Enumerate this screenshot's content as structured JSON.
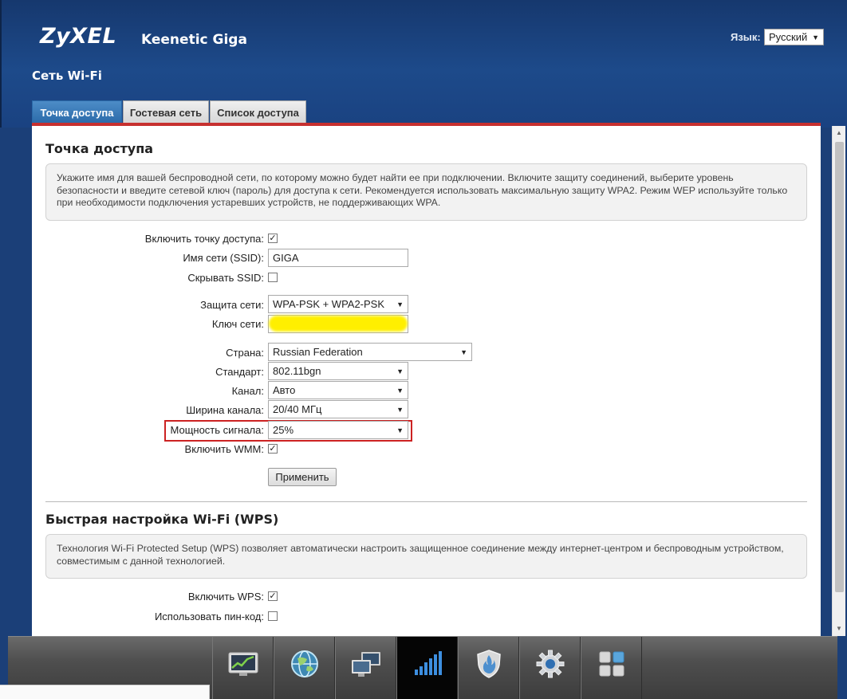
{
  "header": {
    "brand": "ZyXEL",
    "model": "Keenetic Giga",
    "language_label": "Язык:",
    "language_value": "Русский",
    "page_title": "Сеть Wi-Fi"
  },
  "tabs": [
    {
      "label": "Точка доступа",
      "active": true
    },
    {
      "label": "Гостевая сеть",
      "active": false
    },
    {
      "label": "Список доступа",
      "active": false
    }
  ],
  "access_point": {
    "title": "Точка доступа",
    "info": "Укажите имя для вашей беспроводной сети, по которому можно будет найти ее при подключении. Включите защиту соединений, выберите уровень безопасности и введите сетевой ключ (пароль) для доступа к сети. Рекомендуется использовать максимальную защиту WPA2. Режим WEP используйте только при необходимости подключения устаревших устройств, не поддерживающих WPA.",
    "enable_label": "Включить точку доступа:",
    "enable_checked": true,
    "ssid_label": "Имя сети (SSID):",
    "ssid_value": "GIGA",
    "hide_ssid_label": "Скрывать SSID:",
    "hide_ssid_checked": false,
    "security_label": "Защита сети:",
    "security_value": "WPA-PSK + WPA2-PSK",
    "key_label": "Ключ сети:",
    "country_label": "Страна:",
    "country_value": "Russian Federation",
    "standard_label": "Стандарт:",
    "standard_value": "802.11bgn",
    "channel_label": "Канал:",
    "channel_value": "Авто",
    "width_label": "Ширина канала:",
    "width_value": "20/40 МГц",
    "power_label": "Мощность сигнала:",
    "power_value": "25%",
    "wmm_label": "Включить WMM:",
    "wmm_checked": true,
    "apply_label": "Применить"
  },
  "wps": {
    "title": "Быстрая настройка Wi-Fi (WPS)",
    "info": "Технология Wi-Fi Protected Setup (WPS) позволяет автоматически настроить защищенное соединение между интернет-центром и беспроводным устройством, совместимым с данной технологией.",
    "enable_label": "Включить WPS:",
    "enable_checked": true,
    "pin_label": "Использовать пин-код:",
    "pin_checked": false
  },
  "dock": [
    {
      "icon": "monitor-chart-icon",
      "active": false
    },
    {
      "icon": "globe-icon",
      "active": false
    },
    {
      "icon": "computers-icon",
      "active": false
    },
    {
      "icon": "wifi-signal-icon",
      "active": true
    },
    {
      "icon": "firewall-shield-icon",
      "active": false
    },
    {
      "icon": "gear-icon",
      "active": false
    },
    {
      "icon": "apps-grid-icon",
      "active": false
    }
  ],
  "colors": {
    "header_blue": "#1d4a8a",
    "tab_active": "#2a6aa9",
    "accent_red": "#c7302f",
    "highlight_yellow": "#ffef00"
  }
}
